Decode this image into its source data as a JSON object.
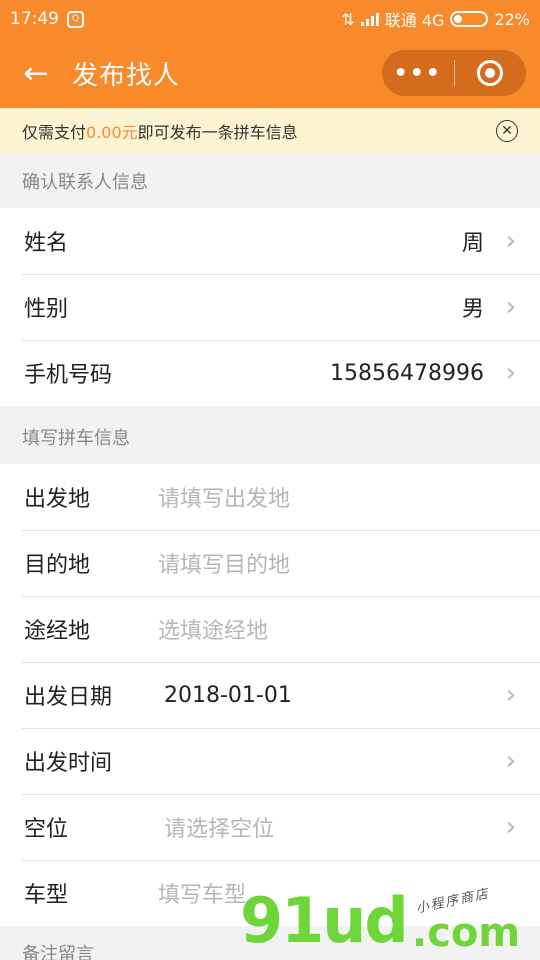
{
  "status_bar": {
    "time": "17:49",
    "app_badge": "Q",
    "carrier": "联通 4G",
    "battery": "22%",
    "battery_level": 0.22
  },
  "nav": {
    "back_icon": "arrow-left-icon",
    "title": "发布找人",
    "more_label": "•••",
    "close_icon": "target-icon"
  },
  "notice": {
    "prefix": "仅需支付",
    "amount": "0.00元",
    "suffix": "即可发布一条拼车信息",
    "close_icon": "circle-x-icon",
    "close_label": "✕"
  },
  "section_contact": {
    "title": "确认联系人信息",
    "rows": [
      {
        "label": "姓名",
        "value": "周"
      },
      {
        "label": "性别",
        "value": "男"
      },
      {
        "label": "手机号码",
        "value": "15856478996"
      }
    ]
  },
  "section_trip": {
    "title": "填写拼车信息",
    "departure": {
      "label": "出发地",
      "placeholder": "请填写出发地"
    },
    "destination": {
      "label": "目的地",
      "placeholder": "请填写目的地"
    },
    "via": {
      "label": "途经地",
      "placeholder": "选填途经地"
    },
    "date": {
      "label": "出发日期",
      "value": "2018-01-01"
    },
    "time": {
      "label": "出发时间",
      "value": ""
    },
    "seats": {
      "label": "空位",
      "placeholder": "请选择空位"
    },
    "car_model": {
      "label": "车型",
      "placeholder": "填写车型"
    }
  },
  "section_remark": {
    "title": "备注留言"
  },
  "chevron": "›",
  "watermark": {
    "brand": "91ud",
    "domain": ".com",
    "tagline": "小程序商店"
  },
  "colors": {
    "brand_orange": "#f88a2c",
    "notice_bg": "#fcf3d2",
    "placeholder_gray": "#b6b6b6",
    "watermark_green": "#6fd63a"
  }
}
